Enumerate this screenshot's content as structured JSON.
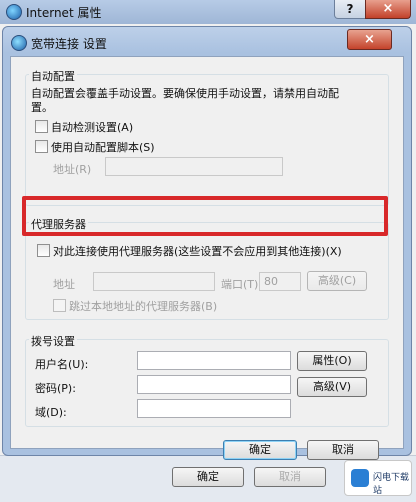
{
  "outer": {
    "title": "Internet 属性",
    "help_label": "?",
    "close_label": "×",
    "ok_label": "确定",
    "cancel_label": "取消"
  },
  "dialog": {
    "title": "宽带连接 设置",
    "close_label": "×"
  },
  "auto_config": {
    "group_label": "自动配置",
    "description_line1": "自动配置会覆盖手动设置。要确保使用手动设置，请禁用自动配",
    "description_line2": "置。",
    "auto_detect_label": "自动检测设置(A)",
    "use_script_label": "使用自动配置脚本(S)",
    "address_label": "地址(R)",
    "address_value": ""
  },
  "proxy": {
    "group_label": "代理服务器",
    "use_proxy_label": "对此连接使用代理服务器(这些设置不会应用到其他连接)(X)",
    "address_label": "地址",
    "address_value": "",
    "port_label": "端口(T):",
    "port_value": "80",
    "advanced_label": "高级(C)",
    "bypass_local_label": "跳过本地地址的代理服务器(B)"
  },
  "dialup": {
    "group_label": "拨号设置",
    "username_label": "用户名(U):",
    "username_value": "",
    "properties_label": "属性(O)",
    "password_label": "密码(P):",
    "password_value": "",
    "advanced_label": "高级(V)",
    "domain_label": "域(D):",
    "domain_value": ""
  },
  "buttons": {
    "ok_label": "确定",
    "cancel_label": "取消"
  },
  "watermark": {
    "text": "闪电下载站"
  },
  "colors": {
    "highlight": "#d8282a",
    "title_bar": "#a9c1e0",
    "close_button": "#c4432b"
  }
}
